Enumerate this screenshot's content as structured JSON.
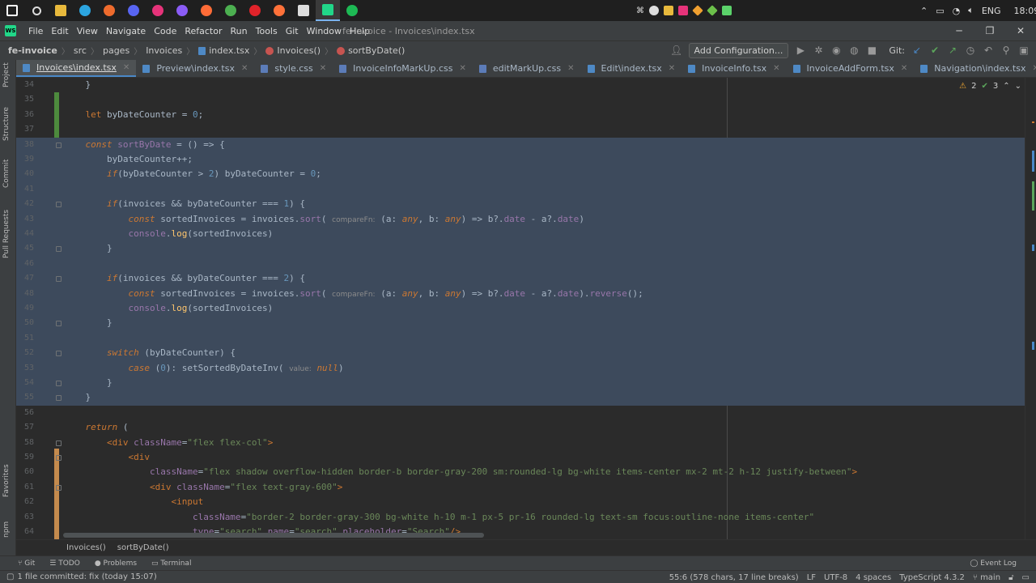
{
  "taskbar": {
    "apps": [
      {
        "name": "windows-start",
        "color": "#ffffff"
      },
      {
        "name": "search",
        "color": "#dddddd"
      },
      {
        "name": "file-explorer",
        "color": "#e8b93c"
      },
      {
        "name": "telegram",
        "color": "#2ca5e0"
      },
      {
        "name": "media-player",
        "color": "#ee6b2d"
      },
      {
        "name": "discord",
        "color": "#5865f2"
      },
      {
        "name": "app-pink",
        "color": "#e6337a"
      },
      {
        "name": "github-desktop",
        "color": "#8b5cf6"
      },
      {
        "name": "postman",
        "color": "#ff6c37"
      },
      {
        "name": "chrome",
        "color": "#4caf50"
      },
      {
        "name": "opera",
        "color": "#e0232a"
      },
      {
        "name": "firefox",
        "color": "#ff7139"
      },
      {
        "name": "settings",
        "color": "#dddddd"
      },
      {
        "name": "webstorm",
        "color": "#21d789"
      },
      {
        "name": "spotify",
        "color": "#1db954"
      }
    ],
    "lang": "ENG",
    "time": "18:09"
  },
  "menu": {
    "items": [
      "File",
      "Edit",
      "View",
      "Navigate",
      "Code",
      "Refactor",
      "Run",
      "Tools",
      "Git",
      "Window",
      "Help"
    ],
    "title": "fe-invoice - Invoices\\index.tsx"
  },
  "nav": {
    "project": "fe-invoice",
    "crumbs": [
      "src",
      "pages",
      "Invoices",
      "index.tsx",
      "Invoices()",
      "sortByDate()"
    ],
    "add_configuration": "Add Configuration...",
    "git_label": "Git:"
  },
  "tabs": [
    {
      "label": "Invoices\\index.tsx",
      "type": "tsx",
      "active": true
    },
    {
      "label": "Preview\\index.tsx",
      "type": "tsx",
      "active": false
    },
    {
      "label": "style.css",
      "type": "css",
      "active": false
    },
    {
      "label": "InvoiceInfoMarkUp.css",
      "type": "css",
      "active": false
    },
    {
      "label": "editMarkUp.css",
      "type": "css",
      "active": false
    },
    {
      "label": "Edit\\index.tsx",
      "type": "tsx",
      "active": false
    },
    {
      "label": "InvoiceInfo.tsx",
      "type": "tsx",
      "active": false
    },
    {
      "label": "InvoiceAddForm.tsx",
      "type": "tsx",
      "active": false
    },
    {
      "label": "Navigation\\index.tsx",
      "type": "tsx",
      "active": false
    }
  ],
  "side_tabs": [
    "Project",
    "Structure",
    "Commit",
    "Pull Requests",
    "Favorites",
    "npm"
  ],
  "inspections": {
    "warnings": "2",
    "weak_warnings": "3"
  },
  "code_lines": [
    {
      "n": "34",
      "html": "    }"
    },
    {
      "n": "35",
      "html": ""
    },
    {
      "n": "36",
      "html": "    <span class='kw'>let</span> byDateCounter = <span class='num'>0</span>;"
    },
    {
      "n": "37",
      "html": ""
    },
    {
      "n": "38",
      "html": "    <span class='kwi'>const</span> <span class='pur'>sortByDate</span> = () => {"
    },
    {
      "n": "39",
      "html": "        byDateCounter++;"
    },
    {
      "n": "40",
      "html": "        <span class='kwi'>if</span>(byDateCounter > <span class='num'>2</span>) byDateCounter = <span class='num'>0</span>;"
    },
    {
      "n": "41",
      "html": ""
    },
    {
      "n": "42",
      "html": "        <span class='kwi'>if</span>(invoices && byDateCounter === <span class='num'>1</span>) {"
    },
    {
      "n": "43",
      "html": "            <span class='kwi'>const</span> sortedInvoices = invoices.<span class='pur'>sort</span>( <span class='hint'>compareFn:</span> (a: <span class='kwi'>any</span>, b: <span class='kwi'>any</span>) => b?.<span class='pur'>date</span> - a?.<span class='pur'>date</span>)"
    },
    {
      "n": "44",
      "html": "            <span class='pur'>console</span>.<span class='fn'>log</span>(sortedInvoices)"
    },
    {
      "n": "45",
      "html": "        }"
    },
    {
      "n": "46",
      "html": ""
    },
    {
      "n": "47",
      "html": "        <span class='kwi'>if</span>(invoices && byDateCounter === <span class='num'>2</span>) {"
    },
    {
      "n": "48",
      "html": "            <span class='kwi'>const</span> sortedInvoices = invoices.<span class='pur'>sort</span>( <span class='hint'>compareFn:</span> (a: <span class='kwi'>any</span>, b: <span class='kwi'>any</span>) => b?.<span class='pur'>date</span> - a?.<span class='pur'>date</span>).<span class='pur'>reverse</span>();"
    },
    {
      "n": "49",
      "html": "            <span class='pur'>console</span>.<span class='fn'>log</span>(sortedInvoices)"
    },
    {
      "n": "50",
      "html": "        }"
    },
    {
      "n": "51",
      "html": ""
    },
    {
      "n": "52",
      "html": "        <span class='kwi'>switch</span> (byDateCounter) {"
    },
    {
      "n": "53",
      "html": "            <span class='kwi'>case</span> (<span class='num'>0</span>): setSortedByDateInv( <span class='hint'>value:</span> <span class='kwi'>null</span>)"
    },
    {
      "n": "54",
      "html": "        }"
    },
    {
      "n": "55",
      "html": "    }"
    },
    {
      "n": "56",
      "html": ""
    },
    {
      "n": "57",
      "html": "    <span class='kwi'>return</span> ("
    },
    {
      "n": "58",
      "html": "        <span class='kw'>&lt;div</span> <span class='pur'>className</span>=<span class='str'>\"flex flex-col\"</span><span class='kw'>&gt;</span>"
    },
    {
      "n": "59",
      "html": "            <span class='kw'>&lt;div</span>"
    },
    {
      "n": "60",
      "html": "                <span class='pur'>className</span>=<span class='str'>\"flex shadow overflow-hidden border-b border-gray-200 sm:rounded-lg bg-white items-center mx-2 mt-2 h-12 justify-between\"</span><span class='kw'>&gt;</span>"
    },
    {
      "n": "61",
      "html": "                <span class='kw'>&lt;div</span> <span class='pur'>className</span>=<span class='str'>\"flex text-gray-600\"</span><span class='kw'>&gt;</span>"
    },
    {
      "n": "62",
      "html": "                    <span class='kw'>&lt;input</span>"
    },
    {
      "n": "63",
      "html": "                        <span class='pur'>className</span>=<span class='str'>\"border-2 border-gray-300 bg-white h-10 m-1 px-5 pr-16 rounded-lg text-sm focus:outline-none items-center\"</span>"
    },
    {
      "n": "64",
      "html": "                        <span class='pur'>type</span>=<span class='str'>\"search\"</span> <span class='pur'>name</span>=<span class='str'>\"search\"</span> <span class='pur'>placeholder</span>=<span class='str'>\"Search\"</span><span class='kw'>/&gt;</span>"
    }
  ],
  "bottom_crumbs": [
    "Invoices()",
    "sortByDate()"
  ],
  "tool_windows": [
    "Git",
    "TODO",
    "Problems",
    "Terminal"
  ],
  "event_log": "Event Log",
  "status": {
    "message": "1 file committed: fix (today 15:07)",
    "position": "55:6 (578 chars, 17 line breaks)",
    "line_sep": "LF",
    "encoding": "UTF-8",
    "indent": "4 spaces",
    "language": "TypeScript 4.3.2",
    "branch": "main"
  }
}
